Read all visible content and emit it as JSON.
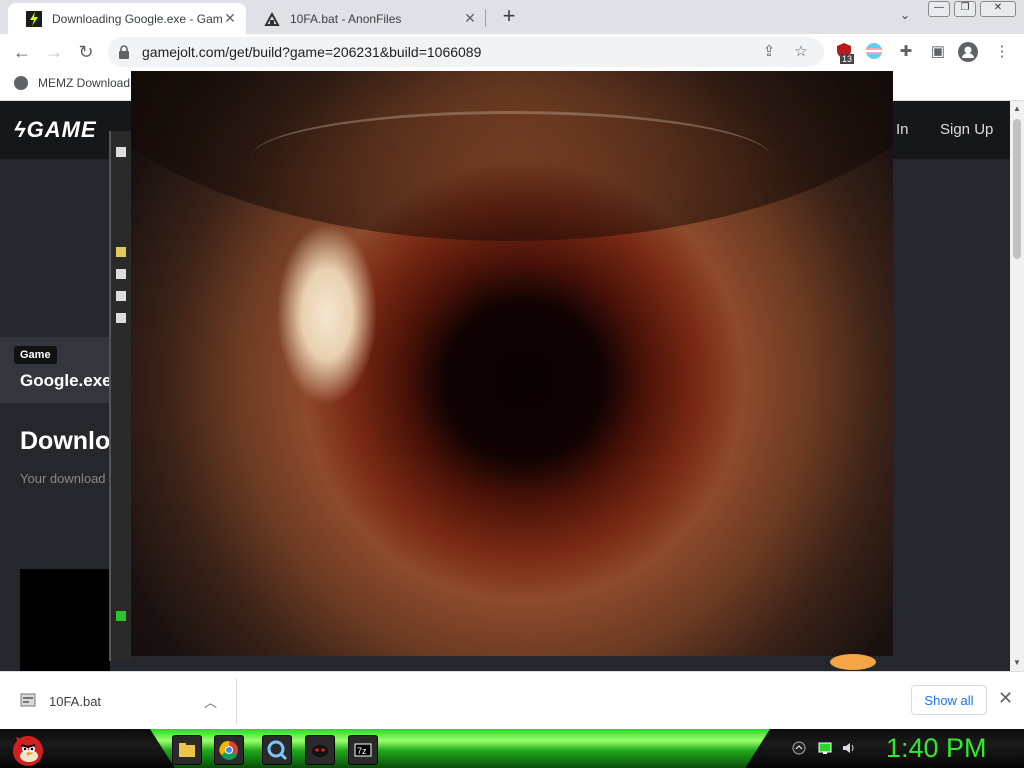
{
  "tabs": [
    {
      "title": "Downloading Google.exe - Game",
      "active": true
    },
    {
      "title": "10FA.bat - AnonFiles",
      "active": false
    }
  ],
  "toolbar": {
    "url": "gamejolt.com/get/build?game=206231&build=1066089",
    "extension_badge": "13"
  },
  "bookmarks": [
    {
      "label": "MEMZ Download"
    }
  ],
  "page": {
    "logo": "GAME",
    "login_label": "In",
    "signup_label": "Sign Up",
    "game_badge": "Game",
    "game_title": "Google.exe",
    "download_heading": "Downlo",
    "download_subtext": "Your download"
  },
  "download_bar": {
    "file_name": "10FA.bat",
    "show_all_label": "Show all"
  },
  "taskbar": {
    "clock": "1:40 PM",
    "apps": [
      "file-explorer",
      "chrome",
      "search-app",
      "memz-app",
      "7zip"
    ]
  },
  "colors": {
    "taskbar_accent": "#2bd62b",
    "clock_color": "#35e62e",
    "link_blue": "#1a73e8"
  }
}
